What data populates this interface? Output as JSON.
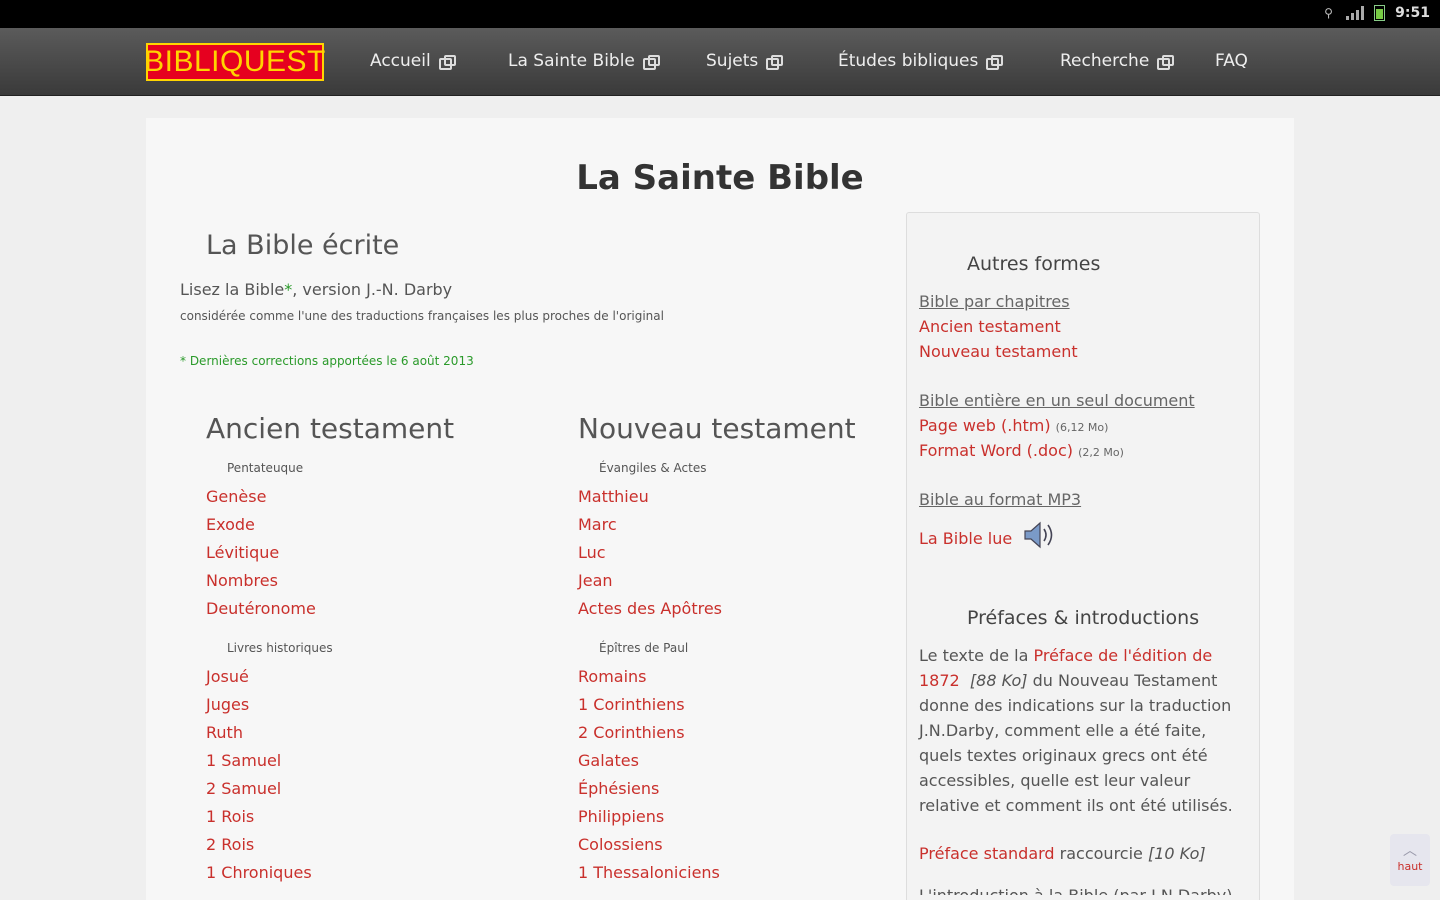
{
  "status_bar": {
    "time": "9:51"
  },
  "nav": {
    "logo": "BIBLIQUEST",
    "items": [
      "Accueil",
      "La Sainte Bible",
      "Sujets",
      "Études bibliques",
      "Recherche",
      "FAQ"
    ]
  },
  "page": {
    "title": "La Sainte Bible",
    "section_title": "La Bible écrite",
    "intro_prefix": "Lisez la Bible",
    "intro_star": "*",
    "intro_suffix": ", version J.-N. Darby",
    "intro_small": "considérée comme l'une des traductions françaises les plus proches de l'original",
    "update_note": "* Dernières corrections apportées le 6 août 2013"
  },
  "ot": {
    "title": "Ancien testament",
    "group1": "Pentateuque",
    "group1_books": [
      "Genèse",
      "Exode",
      "Lévitique",
      "Nombres",
      "Deutéronome"
    ],
    "group2": "Livres historiques",
    "group2_books": [
      "Josué",
      "Juges",
      "Ruth",
      "1 Samuel",
      "2 Samuel",
      "1 Rois",
      "2 Rois",
      "1 Chroniques"
    ]
  },
  "nt": {
    "title": "Nouveau testament",
    "group1": "Évangiles & Actes",
    "group1_books": [
      "Matthieu",
      "Marc",
      "Luc",
      "Jean",
      "Actes des Apôtres"
    ],
    "group2": "Épîtres de Paul",
    "group2_books": [
      "Romains",
      "1 Corinthiens",
      "2 Corinthiens",
      "Galates",
      "Éphésiens",
      "Philippiens",
      "Colossiens",
      "1 Thessaloniciens"
    ]
  },
  "sidebar": {
    "heading": "Autres formes",
    "chapters_label": "Bible par chapitres",
    "chapters_links": [
      "Ancien testament",
      "Nouveau testament"
    ],
    "whole_label": "Bible entière en un seul document",
    "web_link": "Page web (.htm)",
    "web_size": "(6,12 Mo)",
    "word_link": "Format Word (.doc)",
    "word_size": "(2,2 Mo)",
    "mp3_label": "Bible au format MP3",
    "audio_link": "La Bible lue",
    "prefaces_heading": "Préfaces & introductions",
    "preface_text_1": "Le texte de la ",
    "preface_link": "Préface de l'édition de 1872",
    "preface_size": "[88 Ko]",
    "preface_text_2": " du Nouveau Testament donne des indications sur la traduction J.N.Darby, comment elle a été faite, quels textes originaux grecs ont été accessibles, quelle est leur valeur relative et comment ils ont été utilisés.",
    "standard_link": "Préface standard",
    "standard_text": " raccourcie ",
    "standard_size": "[10 Ko]",
    "intro_cut": "L'introduction à la Bible (par J.N.Darby)"
  },
  "to_top": {
    "label": "haut"
  }
}
